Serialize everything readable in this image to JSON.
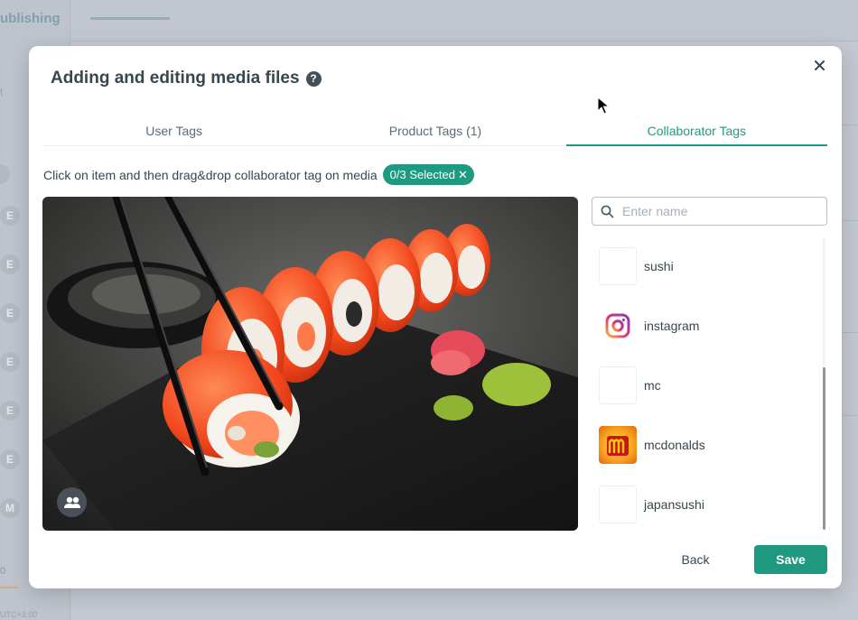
{
  "background": {
    "brand_partial": "ublishing",
    "left_partial_t": "t",
    "left_zero": "0",
    "utc_text": "UTC+3.00",
    "letters": [
      "E",
      "E",
      "E",
      "E",
      "E",
      "E",
      "M"
    ]
  },
  "modal": {
    "title": "Adding and editing media files",
    "help_glyph": "?",
    "close_glyph": "×"
  },
  "tabs": [
    {
      "label": "User Tags",
      "active": false
    },
    {
      "label": "Product Tags (1)",
      "active": false
    },
    {
      "label": "Collaborator Tags",
      "active": true
    }
  ],
  "instruction": {
    "text": "Click on item and then drag&drop collaborator tag on media",
    "selected_badge": "0/3 Selected",
    "badge_close": "✕"
  },
  "search": {
    "placeholder": "Enter name",
    "value": ""
  },
  "tags": [
    {
      "label": "sushi",
      "thumb": "blank"
    },
    {
      "label": "instagram",
      "thumb": "instagram-logo"
    },
    {
      "label": "mc",
      "thumb": "blank"
    },
    {
      "label": "mcdonalds",
      "thumb": "mcdonalds-logo"
    },
    {
      "label": "japansushi",
      "thumb": "blank"
    }
  ],
  "footer": {
    "back_label": "Back",
    "save_label": "Save"
  },
  "colors": {
    "accent": "#1f9a81",
    "title": "#37474f"
  }
}
